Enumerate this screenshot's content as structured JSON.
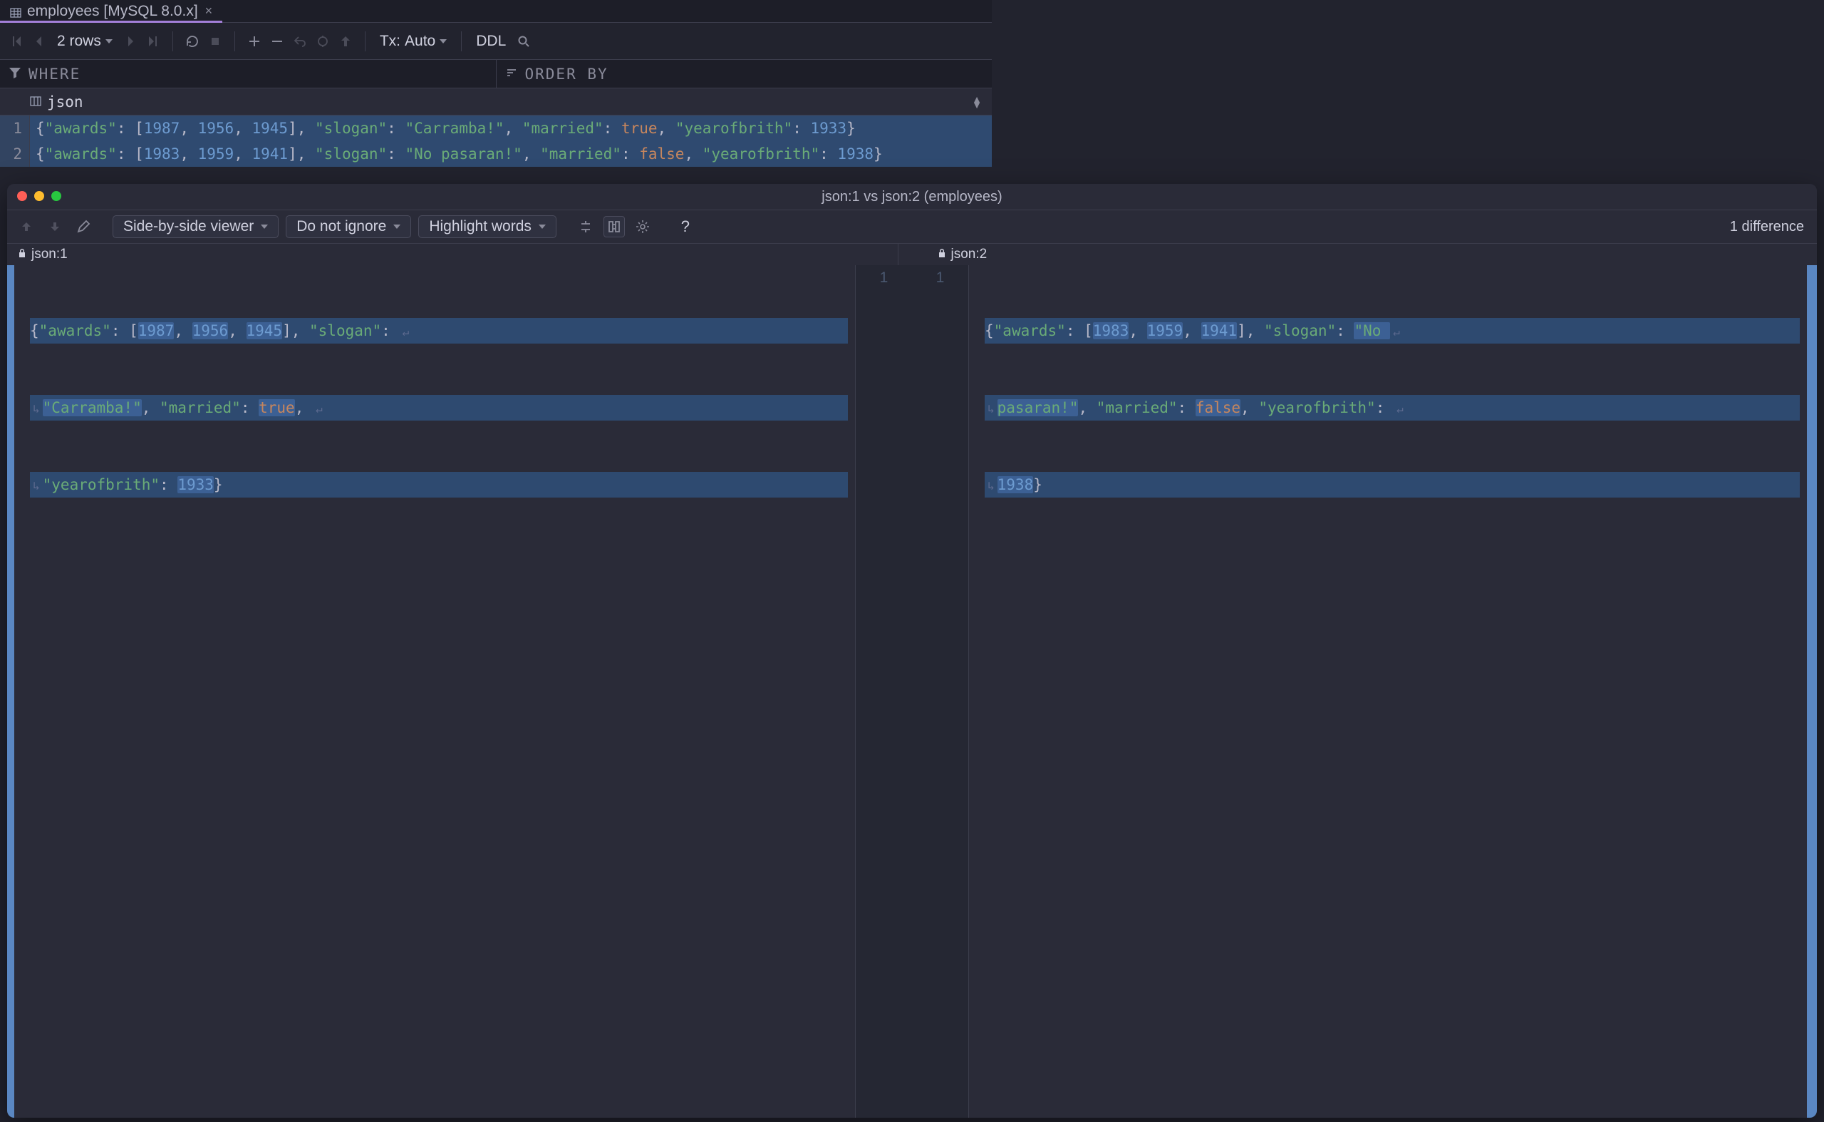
{
  "tab": {
    "title": "employees [MySQL 8.0.x]"
  },
  "toolbar": {
    "rows_label": "2 rows",
    "tx_label": "Tx:",
    "tx_mode": "Auto",
    "ddl_label": "DDL"
  },
  "filterbar": {
    "where": "WHERE",
    "orderby": "ORDER BY"
  },
  "column": {
    "name": "json"
  },
  "rows": [
    {
      "n": "1",
      "awards_key": "\"awards\"",
      "awards": [
        "1987",
        "1956",
        "1945"
      ],
      "slogan_key": "\"slogan\"",
      "slogan": "\"Carramba!\"",
      "married_key": "\"married\"",
      "married": "true",
      "year_key": "\"yearofbrith\"",
      "year": "1933"
    },
    {
      "n": "2",
      "awards_key": "\"awards\"",
      "awards": [
        "1983",
        "1959",
        "1941"
      ],
      "slogan_key": "\"slogan\"",
      "slogan": "\"No pasaran!\"",
      "married_key": "\"married\"",
      "married": "false",
      "year_key": "\"yearofbrith\"",
      "year": "1938"
    }
  ],
  "diff": {
    "title": "json:1 vs json:2 (employees)",
    "viewer_mode": "Side-by-side viewer",
    "ignore_mode": "Do not ignore",
    "highlight_mode": "Highlight words",
    "count_label": "1 difference",
    "left_name": "json:1",
    "right_name": "json:2",
    "center": {
      "l": "1",
      "r": "1"
    },
    "left": {
      "l1": {
        "pre": "{",
        "awards_k": "\"awards\"",
        "p1": ": [",
        "a0": "1987",
        "c": ", ",
        "a1": "1956",
        "a2": "1945",
        "p2": "], ",
        "slogan_k": "\"slogan\"",
        "p3": ": "
      },
      "l2": {
        "slogan": "\"Carramba!\"",
        "p1": ", ",
        "married_k": "\"married\"",
        "p2": ": ",
        "married": "true",
        "p3": ", "
      },
      "l3": {
        "year_k": "\"yearofbrith\"",
        "p1": ": ",
        "year": "1933",
        "p2": "}"
      }
    },
    "right": {
      "l1": {
        "pre": "{",
        "awards_k": "\"awards\"",
        "p1": ": [",
        "a0": "1983",
        "c": ", ",
        "a1": "1959",
        "a2": "1941",
        "p2": "], ",
        "slogan_k": "\"slogan\"",
        "p3": ": ",
        "slogan0": "\"No "
      },
      "l2": {
        "slogan1": "pasaran!\"",
        "p1": ", ",
        "married_k": "\"married\"",
        "p2": ": ",
        "married": "false",
        "p3": ", ",
        "year_k": "\"yearofbrith\"",
        "p4": ": "
      },
      "l3": {
        "year": "1938",
        "p2": "}"
      }
    }
  }
}
